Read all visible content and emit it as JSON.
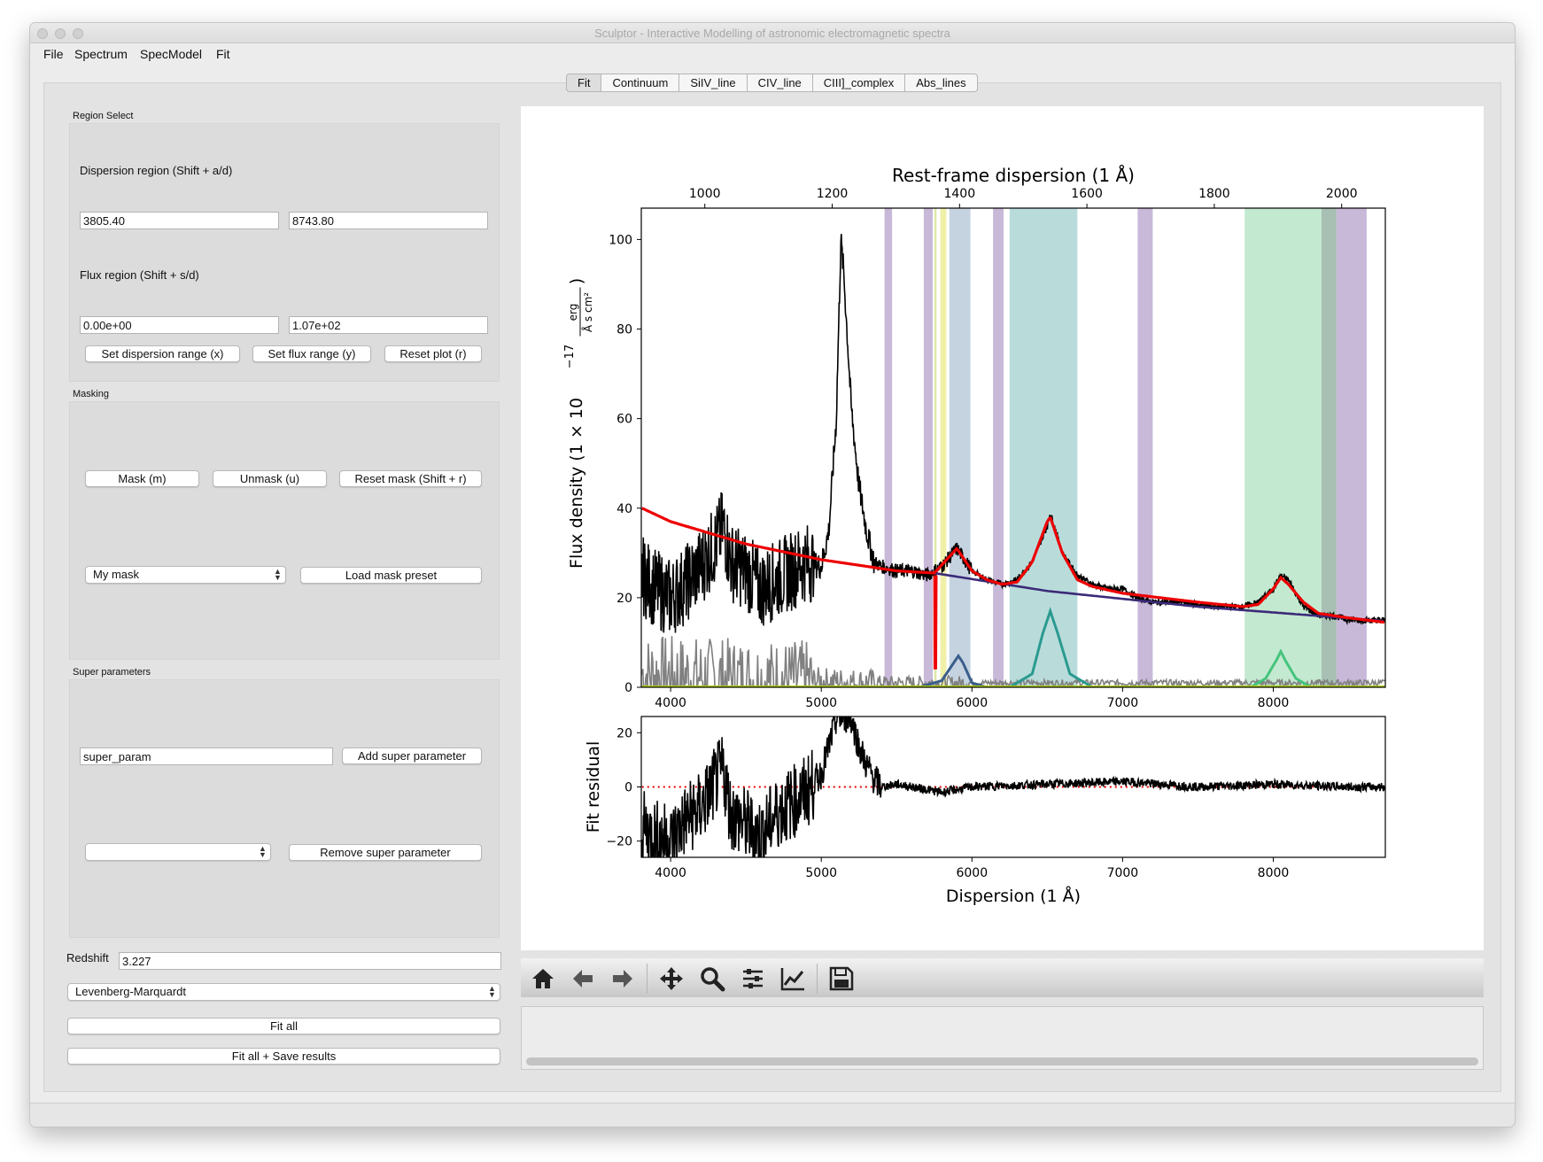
{
  "window": {
    "title": "Sculptor - Interactive Modelling of astronomic electromagnetic spectra"
  },
  "menu": {
    "items": [
      "File",
      "Spectrum",
      "SpecModel",
      "Fit"
    ]
  },
  "tabs": [
    {
      "label": "Fit",
      "selected": true
    },
    {
      "label": "Continuum",
      "selected": false
    },
    {
      "label": "SiIV_line",
      "selected": false
    },
    {
      "label": "CIV_line",
      "selected": false
    },
    {
      "label": "CIII]_complex",
      "selected": false
    },
    {
      "label": "Abs_lines",
      "selected": false
    }
  ],
  "region_select": {
    "title": "Region Select",
    "dispersion_label": "Dispersion region (Shift + a/d)",
    "disp_min": "3805.40",
    "disp_max": "8743.80",
    "flux_label": "Flux region (Shift + s/d)",
    "flux_min": "0.00e+00",
    "flux_max": "1.07e+02",
    "set_dispersion_button": "Set dispersion range (x)",
    "set_flux_button": "Set flux range (y)",
    "reset_plot_button": "Reset plot (r)"
  },
  "masking": {
    "title": "Masking",
    "mask_button": "Mask (m)",
    "unmask_button": "Unmask (u)",
    "reset_mask_button": "Reset mask (Shift + r)",
    "mask_preset_selected": "My mask",
    "load_preset_button": "Load mask preset"
  },
  "super_parameters": {
    "title": "Super parameters",
    "name_value": "super_param",
    "add_button": "Add super parameter",
    "selected": "",
    "remove_button": "Remove super parameter"
  },
  "fit_controls": {
    "redshift_label": "Redshift",
    "redshift_value": "3.227",
    "fit_method": "Levenberg-Marquardt",
    "fit_all_button": "Fit all",
    "fit_save_button": "Fit all + Save results"
  },
  "toolbar": {
    "icons": [
      "home-icon",
      "back-arrow-icon",
      "forward-arrow-icon",
      "pan-icon",
      "zoom-icon",
      "subplots-config-icon",
      "edit-axes-icon",
      "save-icon"
    ]
  },
  "chart_data": [
    {
      "type": "line",
      "title": "Rest-frame dispersion (1 Å)",
      "xlabel": "",
      "ylabel": "Flux density (1 × 10⁻¹⁷ erg / (Å s cm²))",
      "ylabel_main": "Flux density (1 × 10",
      "ylabel_exp": "−17",
      "ylabel_unit_num": "erg",
      "ylabel_unit_den": "Å s cm²",
      "xlim": [
        3805.4,
        8743.8
      ],
      "ylim": [
        0,
        107
      ],
      "xticks": [
        4000,
        5000,
        6000,
        7000,
        8000
      ],
      "yticks": [
        0,
        20,
        40,
        60,
        80,
        100
      ],
      "top_axis_ticks": [
        1000,
        1200,
        1400,
        1600,
        1800,
        2000
      ],
      "redshift": 3.227,
      "masked_regions": [
        {
          "x0": 5420,
          "x1": 5470,
          "color": "#c9b9d9"
        },
        {
          "x0": 5680,
          "x1": 5740,
          "color": "#c9b9d9"
        },
        {
          "x0": 5750,
          "x1": 5765,
          "color": "#dde8a8"
        },
        {
          "x0": 5790,
          "x1": 5830,
          "color": "#f0f0a8"
        },
        {
          "x0": 5850,
          "x1": 5990,
          "color": "#c5d3e1"
        },
        {
          "x0": 6140,
          "x1": 6210,
          "color": "#c9b9d9"
        },
        {
          "x0": 6250,
          "x1": 6700,
          "color": "#b9dcdb"
        },
        {
          "x0": 7100,
          "x1": 7200,
          "color": "#c9b9d9"
        },
        {
          "x0": 7810,
          "x1": 8320,
          "color": "#c4e9d1"
        },
        {
          "x0": 8320,
          "x1": 8420,
          "color": "#a8c0b4"
        },
        {
          "x0": 8420,
          "x1": 8620,
          "color": "#c9b9d9"
        }
      ],
      "series": [
        {
          "name": "",
          "color": "#000000",
          "description": "spectrum",
          "x": [
            3810,
            3900,
            4000,
            4100,
            4200,
            4300,
            4350,
            4400,
            4500,
            4600,
            4700,
            4800,
            4900,
            5000,
            5050,
            5100,
            5130,
            5150,
            5200,
            5250,
            5300,
            5350,
            5400,
            5500,
            5600,
            5700,
            5800,
            5900,
            6000,
            6100,
            6200,
            6300,
            6400,
            6500,
            6520,
            6600,
            6700,
            6800,
            6900,
            7000,
            7100,
            7200,
            7400,
            7600,
            7800,
            7900,
            8000,
            8050,
            8100,
            8200,
            8300,
            8400,
            8500,
            8600,
            8743
          ],
          "y": [
            25,
            22,
            20,
            23,
            27,
            32,
            36,
            28,
            26,
            22,
            24,
            26,
            28,
            27,
            35,
            60,
            100,
            92,
            62,
            45,
            35,
            28,
            27,
            26,
            26,
            25,
            27,
            31,
            26,
            24,
            23,
            24,
            28,
            36,
            39,
            30,
            25,
            23,
            22,
            22,
            20,
            19,
            19,
            18,
            18,
            19,
            22,
            25,
            24,
            18,
            16,
            16,
            15,
            15,
            15
          ]
        },
        {
          "name": "",
          "color": "#ee0000",
          "description": "model",
          "x": [
            3810,
            4000,
            4500,
            5000,
            5500,
            5750,
            5900,
            6000,
            6100,
            6200,
            6300,
            6400,
            6500,
            6520,
            6600,
            6700,
            6800,
            7000,
            7500,
            7800,
            7900,
            8000,
            8050,
            8100,
            8200,
            8300,
            8500,
            8743
          ],
          "y": [
            40,
            37,
            32,
            28.5,
            26,
            25.5,
            31,
            26,
            24,
            23,
            23.5,
            28,
            37,
            38,
            30,
            24,
            22.5,
            21,
            19,
            18,
            18.5,
            22,
            24.5,
            23,
            19,
            16.5,
            15.5,
            14.5
          ]
        },
        {
          "name": "",
          "color": "#3b2a78",
          "description": "continuum",
          "x": [
            5750,
            6500,
            7500,
            8743
          ],
          "y": [
            25.5,
            21.5,
            18,
            14.8
          ]
        },
        {
          "name": "",
          "color": "#3a5e8c",
          "description": "SiIV line",
          "x": [
            5650,
            5800,
            5880,
            5910,
            5940,
            6000,
            6100
          ],
          "y": [
            0,
            1.5,
            5.5,
            7,
            5.5,
            1,
            0
          ]
        },
        {
          "name": "",
          "color": "#2a9a8f",
          "description": "CIV line",
          "x": [
            6250,
            6400,
            6470,
            6520,
            6570,
            6650,
            6800
          ],
          "y": [
            0,
            3,
            12,
            17,
            12,
            3,
            0
          ]
        },
        {
          "name": "",
          "color": "#45c47c",
          "description": "CIII] complex",
          "x": [
            7850,
            7950,
            8020,
            8050,
            8080,
            8150,
            8250
          ],
          "y": [
            0,
            2,
            6,
            8,
            6,
            2,
            0
          ]
        },
        {
          "name": "",
          "color": "#808080",
          "description": "error",
          "x": [
            3810,
            4500,
            5000,
            5500,
            6000,
            7000,
            8000,
            8743
          ],
          "y": [
            3,
            2,
            1.5,
            1,
            1,
            1,
            1,
            1
          ]
        }
      ]
    },
    {
      "type": "line",
      "title": "",
      "xlabel": "Dispersion (1 Å)",
      "ylabel": "Fit residual",
      "xlim": [
        3805.4,
        8743.8
      ],
      "ylim": [
        -26,
        26
      ],
      "xticks": [
        4000,
        5000,
        6000,
        7000,
        8000
      ],
      "yticks": [
        -20,
        0,
        20
      ],
      "series": [
        {
          "name": "",
          "color": "#000000",
          "description": "residual",
          "x": [
            3810,
            3900,
            4000,
            4100,
            4200,
            4300,
            4350,
            4400,
            4500,
            4600,
            4700,
            4800,
            4900,
            5000,
            5050,
            5100,
            5150,
            5200,
            5250,
            5300,
            5350,
            5400,
            5500,
            5600,
            5800,
            6000,
            6500,
            7000,
            7500,
            8000,
            8500,
            8743
          ],
          "y": [
            -15,
            -18,
            -20,
            -12,
            -8,
            2,
            6,
            -10,
            -14,
            -18,
            -10,
            -6,
            -2,
            5,
            15,
            25,
            26,
            25,
            15,
            8,
            3,
            0,
            1,
            0,
            -2,
            0,
            1,
            2,
            0,
            1,
            0,
            0
          ]
        },
        {
          "name": "",
          "color": "#ee0000",
          "description": "zero line",
          "x": [
            3810,
            8743
          ],
          "y": [
            0,
            0
          ]
        }
      ]
    }
  ]
}
